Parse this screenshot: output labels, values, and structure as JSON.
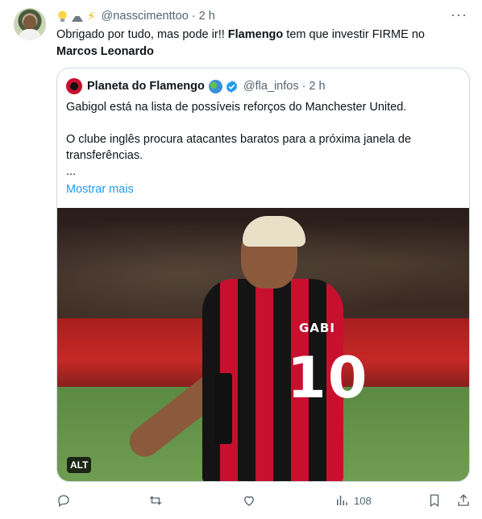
{
  "tweet": {
    "author_handle": "@nasscimenttoo",
    "time": "2 h",
    "text_part1": "Obrigado por tudo, mas pode ir!! ",
    "text_bold1": "Flamengo",
    "text_part2": " tem que investir FIRME no ",
    "text_bold2": "Marcos Leonardo"
  },
  "quote": {
    "name": "Planeta do Flamengo",
    "handle": "@fla_infos",
    "time": "2 h",
    "line1": "Gabigol está na lista de possíveis reforços do Manchester United.",
    "line2": "O clube inglês procura atacantes baratos para a próxima janela de transferências.",
    "ellipsis": "...",
    "show_more": "Mostrar mais"
  },
  "photo": {
    "alt_badge": "ALT",
    "shirt_name": "GABI",
    "shirt_number": "10"
  },
  "actions": {
    "views_count": "108"
  },
  "colors": {
    "link": "#1d9bf0",
    "muted": "#536471",
    "border": "#cfd9de"
  }
}
